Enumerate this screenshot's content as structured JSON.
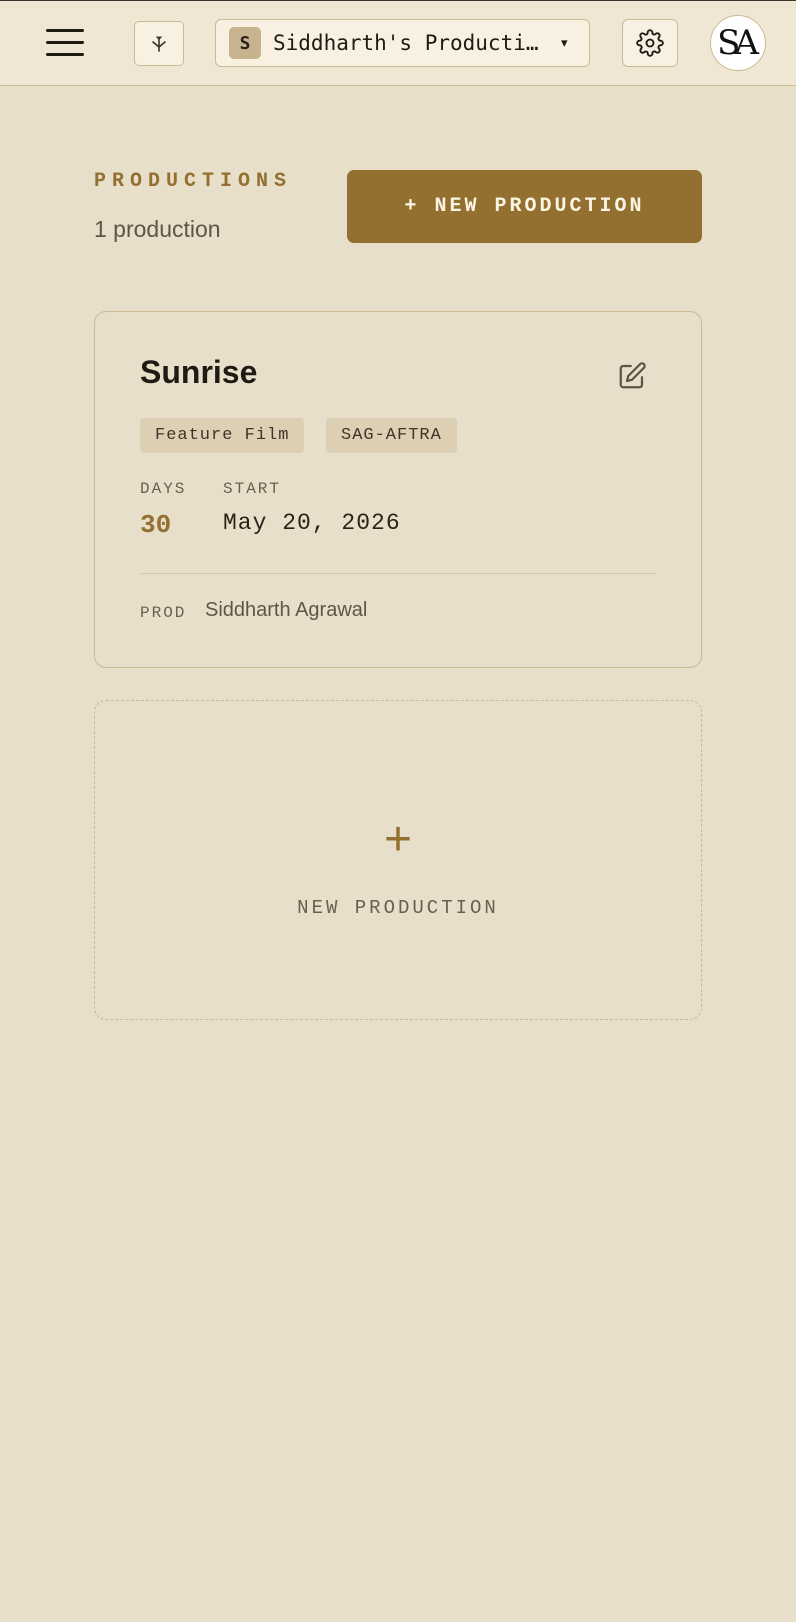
{
  "topbar": {
    "org_badge": "S",
    "org_name": "Siddharth's Producti…",
    "org_caret": "▾",
    "avatar_initials": "SA"
  },
  "productions": {
    "section_label": "PRODUCTIONS",
    "count_text": "1 production",
    "new_button_label": "+ NEW PRODUCTION"
  },
  "cards": [
    {
      "title": "Sunrise",
      "tags": [
        "Feature Film",
        "SAG-AFTRA"
      ],
      "days_label": "DAYS",
      "days_value": "30",
      "start_label": "START",
      "start_value": "May 20, 2026",
      "prod_label": "PROD",
      "prod_name": "Siddharth Agrawal"
    }
  ],
  "add_card": {
    "plus": "+",
    "label": "NEW PRODUCTION"
  },
  "colors": {
    "background": "#e8dfcb",
    "accent": "#93702f",
    "border": "#cdb992"
  }
}
